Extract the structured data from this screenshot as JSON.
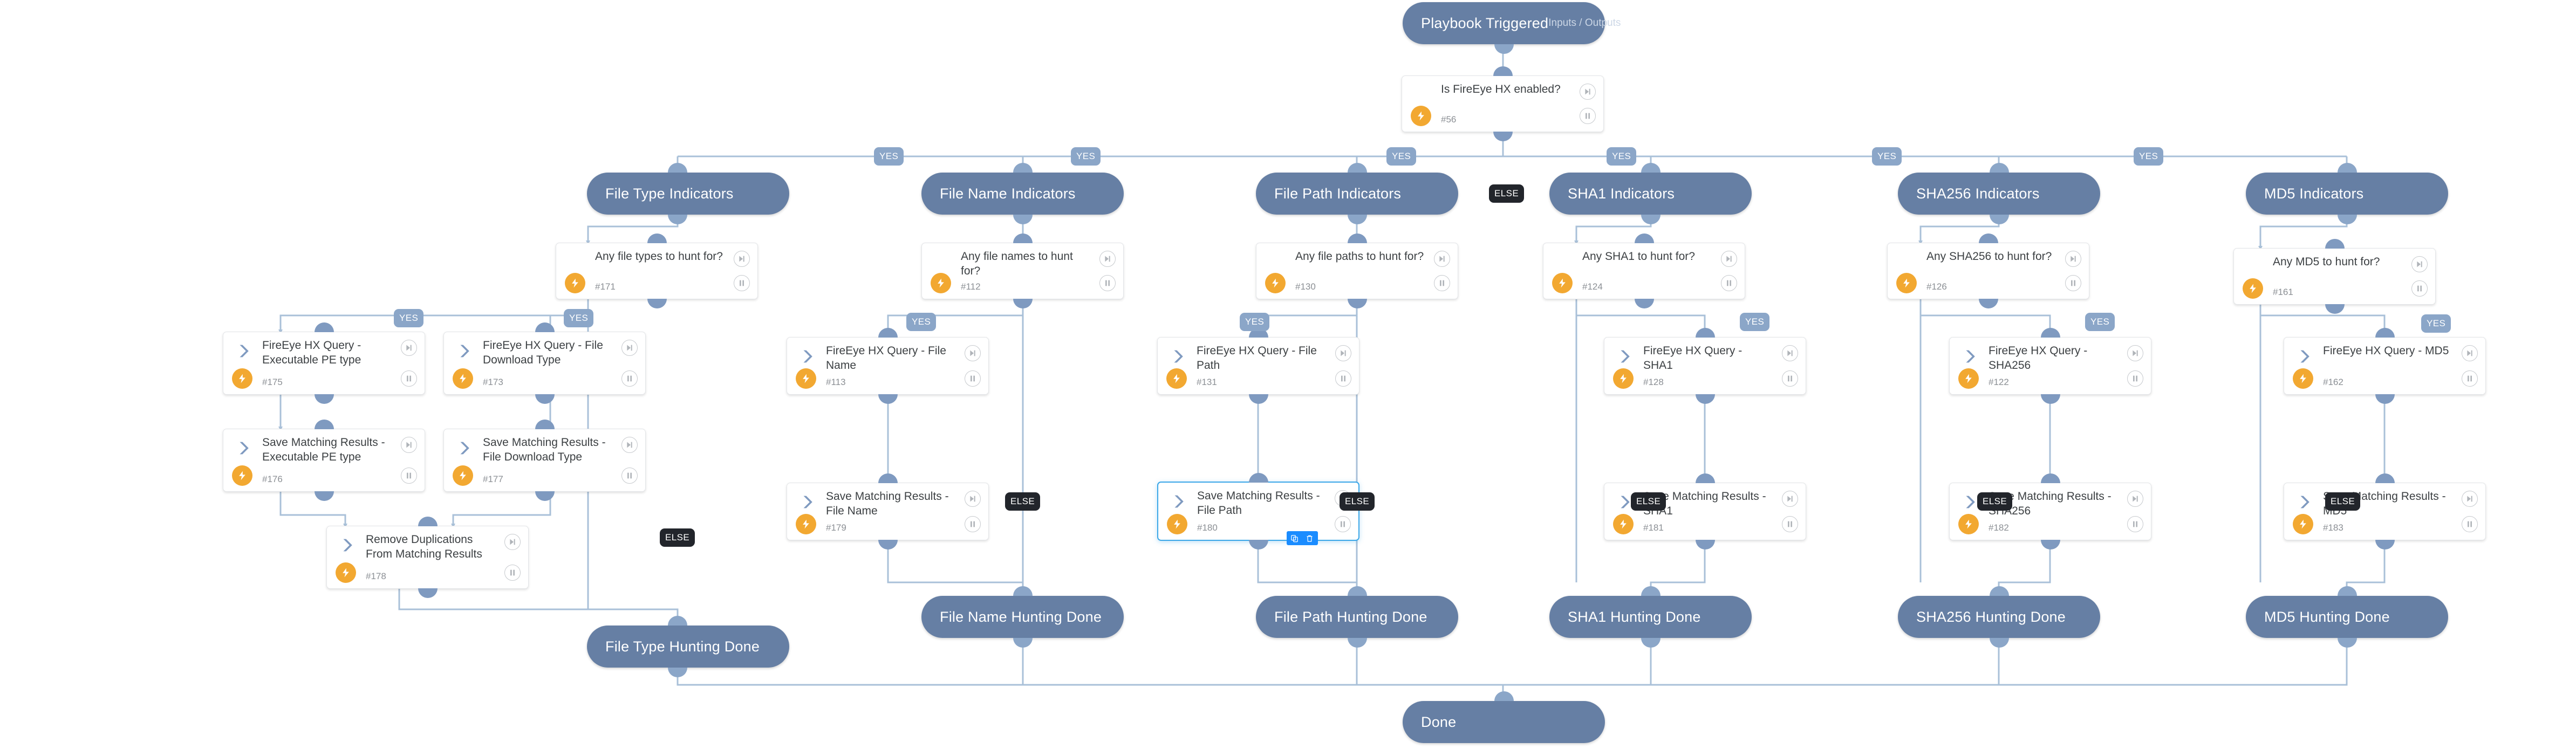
{
  "workflow": {
    "trigger": {
      "label": "Playbook Triggered",
      "sublabel": "Inputs / Outputs"
    },
    "end": {
      "label": "Done"
    },
    "root_condition": {
      "title": "Is FireEye HX enabled?",
      "id": "#56"
    },
    "edge_labels": {
      "yes": "YES",
      "else": "ELSE"
    },
    "selection_actions": {
      "copy": "copy-icon",
      "delete": "trash-icon"
    },
    "icons": {
      "condition": "diamond-icon",
      "task": "chevron-right-icon",
      "automation": "lightning-bolt-icon",
      "step": "skip-forward-icon",
      "pause": "pause-icon"
    },
    "colors": {
      "stage_fill": "#667fa4",
      "edge": "#a9c0d8",
      "bolt": "#f2a831",
      "selected_border": "#3ba7e8",
      "action_bar": "#1a8cff",
      "else_label": "#22252b",
      "yes_label": "#8ba6c8"
    },
    "branches": [
      {
        "key": "file_type",
        "stage": "File Type Indicators",
        "condition": {
          "title": "Any file types to hunt for?",
          "id": "#171"
        },
        "done": "File Type Hunting Done",
        "tasks": [
          {
            "title": "FireEye HX Query - Executable PE type",
            "id": "#175"
          },
          {
            "title": "FireEye HX Query - File Download Type",
            "id": "#173"
          },
          {
            "title": "Save Matching Results - Executable PE type",
            "id": "#176"
          },
          {
            "title": "Save Matching Results - File Download Type",
            "id": "#177"
          },
          {
            "title": "Remove Duplications From Matching Results",
            "id": "#178"
          }
        ]
      },
      {
        "key": "file_name",
        "stage": "File Name Indicators",
        "condition": {
          "title": "Any file names to hunt for?",
          "id": "#112"
        },
        "done": "File Name Hunting Done",
        "tasks": [
          {
            "title": "FireEye HX Query - File Name",
            "id": "#113"
          },
          {
            "title": "Save Matching Results - File Name",
            "id": "#179"
          }
        ]
      },
      {
        "key": "file_path",
        "stage": "File Path Indicators",
        "condition": {
          "title": "Any file paths to hunt for?",
          "id": "#130"
        },
        "done": "File Path Hunting Done",
        "tasks": [
          {
            "title": "FireEye HX Query - File Path",
            "id": "#131"
          },
          {
            "title": "Save Matching Results - File Path",
            "id": "#180"
          }
        ]
      },
      {
        "key": "sha1",
        "stage": "SHA1 Indicators",
        "condition": {
          "title": "Any SHA1 to hunt for?",
          "id": "#124"
        },
        "done": "SHA1 Hunting Done",
        "tasks": [
          {
            "title": "FireEye HX Query - SHA1",
            "id": "#128"
          },
          {
            "title": "Save Matching Results - SHA1",
            "id": "#181"
          }
        ]
      },
      {
        "key": "sha256",
        "stage": "SHA256 Indicators",
        "condition": {
          "title": "Any SHA256 to hunt for?",
          "id": "#126"
        },
        "done": "SHA256 Hunting Done",
        "tasks": [
          {
            "title": "FireEye HX Query - SHA256",
            "id": "#122"
          },
          {
            "title": "Save Matching Results - SHA256",
            "id": "#182"
          }
        ]
      },
      {
        "key": "md5",
        "stage": "MD5 Indicators",
        "condition": {
          "title": "Any MD5 to hunt for?",
          "id": "#161"
        },
        "done": "MD5 Hunting Done",
        "tasks": [
          {
            "title": "FireEye HX Query - MD5",
            "id": "#162"
          },
          {
            "title": "Save Matching Results - MD5",
            "id": "#183"
          }
        ]
      }
    ]
  }
}
